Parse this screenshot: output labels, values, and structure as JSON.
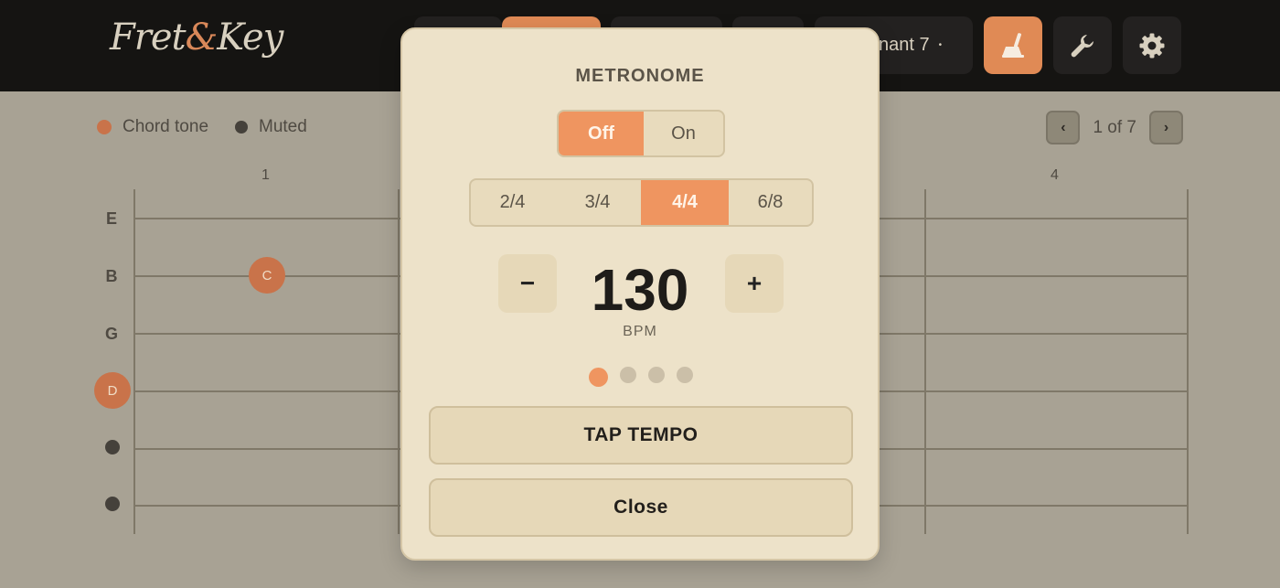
{
  "app": {
    "logo_left": "Fret",
    "logo_amp": "&",
    "logo_right": "Key"
  },
  "toolbar": {
    "chord_selector_label": "nant 7",
    "chord_selector_dot": "•",
    "active_tool_icon": "broom-icon",
    "tools_icon": "wrench-icon",
    "settings_icon": "gear-icon"
  },
  "legend": {
    "chord_tone": "Chord tone",
    "muted": "Muted",
    "chord_tone_color": "#c9734a",
    "muted_color": "#45413b"
  },
  "pager": {
    "prev": "‹",
    "label": "1 of 7",
    "next": "›"
  },
  "fretboard": {
    "fret_numbers": [
      "1",
      "4"
    ],
    "strings": [
      "E",
      "B",
      "G",
      "D",
      "",
      ""
    ],
    "notes": [
      {
        "string": "B",
        "label": "C"
      },
      {
        "string": "D",
        "label": "D"
      }
    ]
  },
  "metronome": {
    "title": "METRONOME",
    "toggle": [
      "Off",
      "On"
    ],
    "toggle_selected": "Off",
    "time_signatures": [
      "2/4",
      "3/4",
      "4/4",
      "6/8"
    ],
    "time_signature_selected": "4/4",
    "minus": "−",
    "bpm": "130",
    "plus": "+",
    "bpm_label": "BPM",
    "beats_total": 4,
    "beat_active": 1,
    "tap_tempo": "TAP TEMPO",
    "close": "Close",
    "accent_color": "#ef9560"
  }
}
